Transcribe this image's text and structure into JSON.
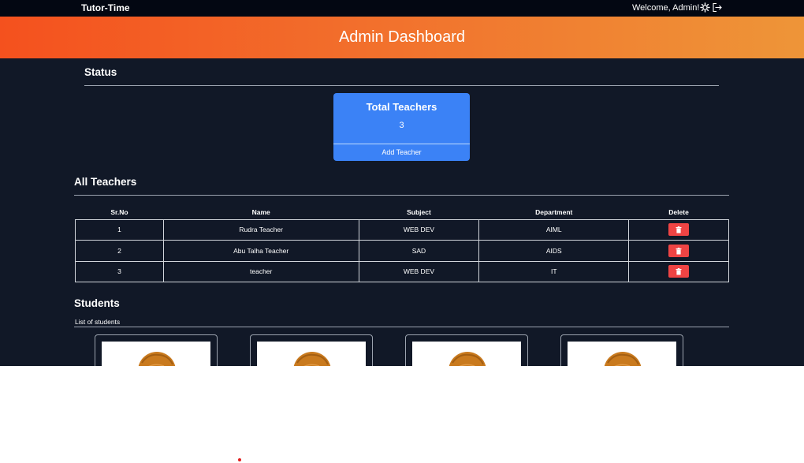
{
  "navbar": {
    "brand": "Tutor-Time",
    "welcome": "Welcome, Admin!",
    "theme_icon": "gear-icon",
    "logout_icon": "logout-icon"
  },
  "banner": {
    "title": "Admin Dashboard"
  },
  "status": {
    "heading": "Status",
    "card": {
      "title": "Total Teachers",
      "value": "3",
      "action": "Add Teacher"
    }
  },
  "teachers": {
    "heading": "All Teachers",
    "columns": [
      "Sr.No",
      "Name",
      "Subject",
      "Department",
      "Delete"
    ],
    "rows": [
      {
        "sr": "1",
        "name": "Rudra Teacher",
        "subject": "WEB DEV",
        "department": "AIML"
      },
      {
        "sr": "2",
        "name": "Abu Talha Teacher",
        "subject": "SAD",
        "department": "AIDS"
      },
      {
        "sr": "3",
        "name": "teacher",
        "subject": "WEB DEV",
        "department": "IT"
      }
    ]
  },
  "students": {
    "heading": "Students",
    "subheading": "List of students",
    "cards": [
      {
        "avatar": "avatar-icon"
      },
      {
        "avatar": "avatar-icon"
      },
      {
        "avatar": "avatar-icon"
      },
      {
        "avatar": "avatar-icon"
      }
    ]
  },
  "colors": {
    "background": "#111827",
    "accent": "#3b82f6",
    "danger": "#ef4444",
    "banner_start": "#f4511e",
    "banner_end": "#ee9538"
  }
}
